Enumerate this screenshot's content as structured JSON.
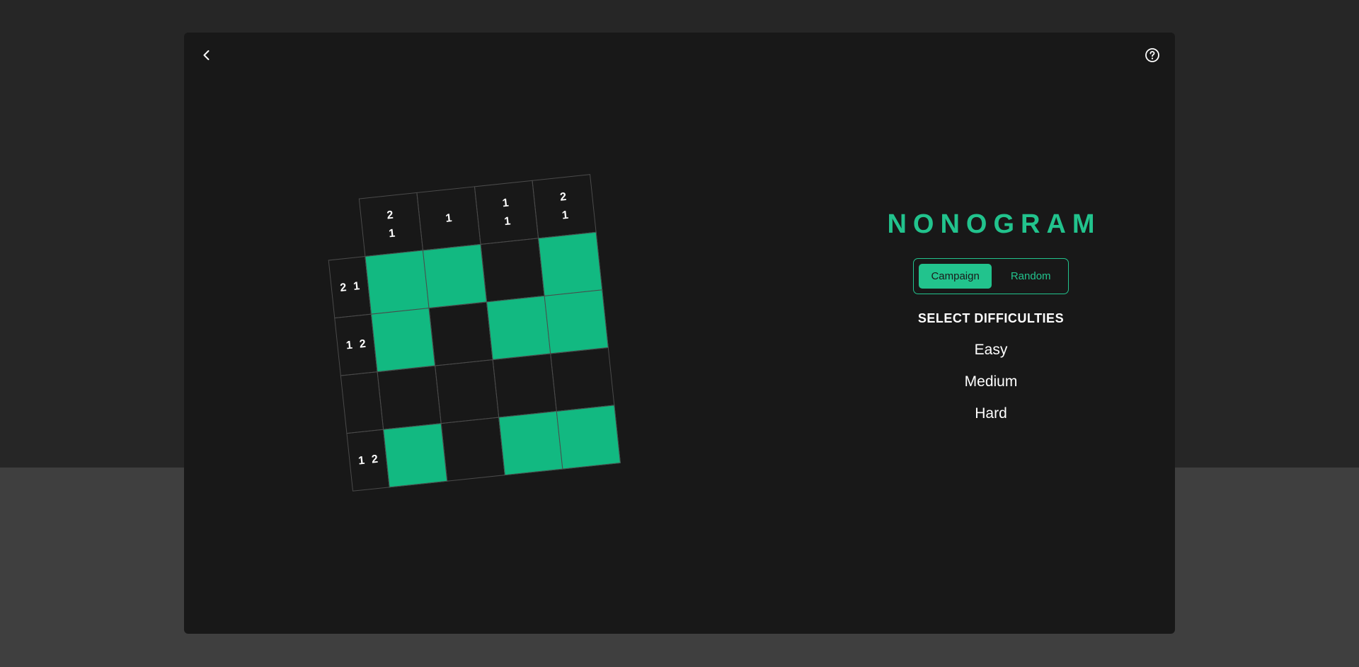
{
  "colors": {
    "accent": "#22c38d",
    "filled_cell": "#12b981",
    "modal_bg": "#181818",
    "page_bg_top": "#262626",
    "page_bg_bottom": "#3f3f3f"
  },
  "header": {
    "back_icon": "chevron-left-icon",
    "help_icon": "question-circle-icon"
  },
  "puzzle": {
    "column_hints": [
      [
        "2",
        "1"
      ],
      [
        "1"
      ],
      [
        "1",
        "1"
      ],
      [
        "2",
        "1"
      ]
    ],
    "row_hints": [
      [
        "2",
        "1"
      ],
      [
        "1",
        "2"
      ],
      [],
      [
        "1",
        "2"
      ]
    ],
    "grid": [
      [
        1,
        1,
        0,
        1
      ],
      [
        1,
        0,
        1,
        1
      ],
      [
        0,
        0,
        0,
        0
      ],
      [
        1,
        0,
        1,
        1
      ]
    ]
  },
  "menu": {
    "title": "NONOGRAM",
    "modes": [
      {
        "label": "Campaign",
        "active": true
      },
      {
        "label": "Random",
        "active": false
      }
    ],
    "select_label": "SELECT DIFFICULTIES",
    "difficulties": [
      "Easy",
      "Medium",
      "Hard"
    ]
  }
}
